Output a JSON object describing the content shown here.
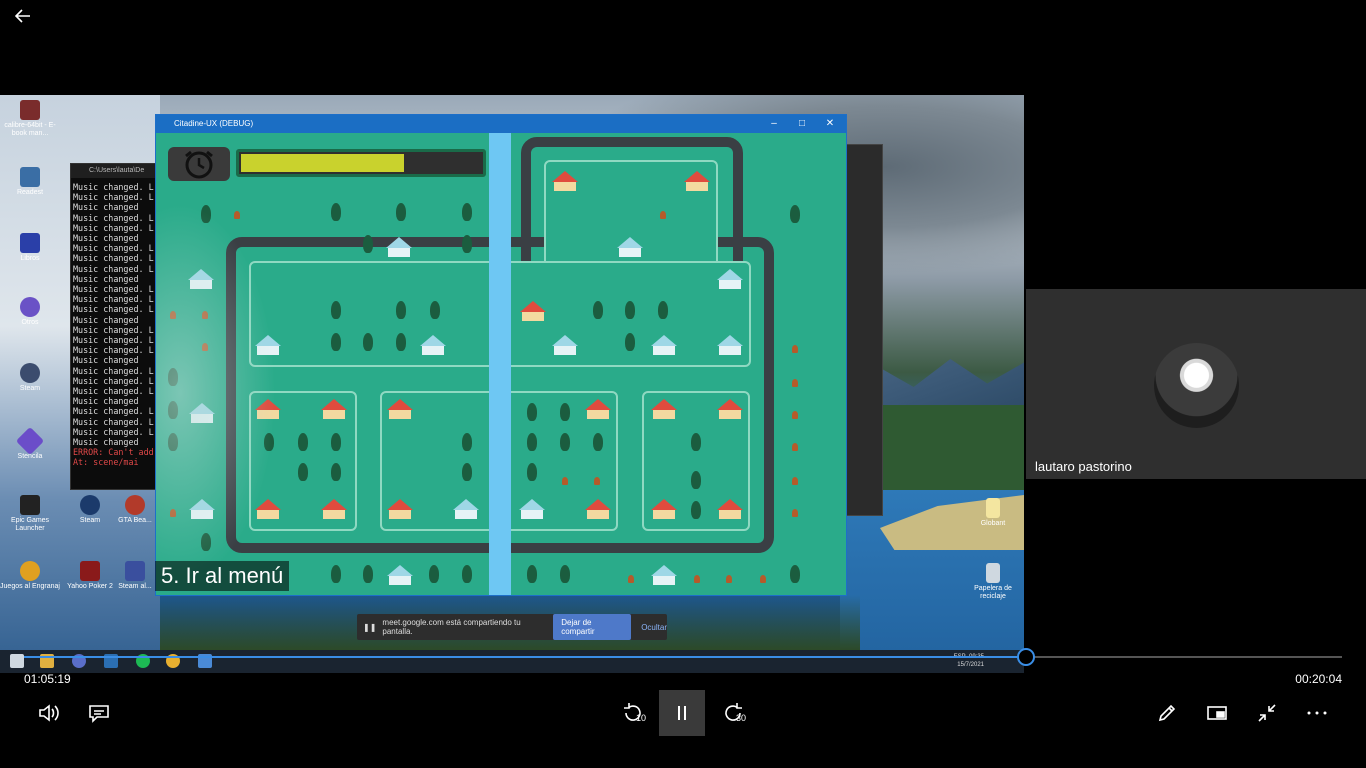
{
  "player": {
    "elapsed": "01:05:19",
    "total": "00:20:04",
    "progress_fraction": 0.76,
    "skip_back_seconds": "10",
    "skip_forward_seconds": "30"
  },
  "icons": {
    "back": "back-arrow-icon",
    "volume": "volume-icon",
    "captions": "captions-icon",
    "skip_back": "skip-back-10-icon",
    "pause": "pause-icon",
    "skip_forward": "skip-forward-30-icon",
    "edit": "pencil-icon",
    "miniplayer": "miniplayer-icon",
    "exit_fullscreen": "exit-fullscreen-icon",
    "more": "more-icon"
  },
  "participant": {
    "name": "lautaro pastorino"
  },
  "video": {
    "game_window_title": "Citadine-UX (DEBUG)",
    "caption": "5. Ir al menú",
    "progress_bar_fraction": 0.68,
    "console_title": "C:\\Users\\lauta\\De",
    "console_lines": [
      "Music changed. L",
      "Music changed. L",
      "Music changed",
      "Music changed. L",
      "Music changed. L",
      "Music changed",
      "Music changed. L",
      "Music changed. L",
      "Music changed. L",
      "Music changed",
      "Music changed. L",
      "Music changed. L",
      "Music changed. L",
      "Music changed",
      "Music changed. L",
      "Music changed. L",
      "Music changed. L",
      "Music changed",
      "Music changed. L",
      "Music changed. L",
      "Music changed. L",
      "Music changed",
      "Music changed. L",
      "Music changed. L",
      "Music changed. L",
      "Music changed",
      "ERROR: Can't add",
      "    At: scene/mai"
    ],
    "share_bar": {
      "message": "meet.google.com está compartiendo tu pantalla.",
      "stop_label": "Dejar de compartir",
      "hide_label": "Ocultar"
    },
    "desktop_icons": [
      "calibre-64bit - E-book man...",
      "Readest",
      "Libros",
      "Otros",
      "Steam",
      "Stencila",
      "Epic Games Launcher",
      "Steam",
      "GTA Bea...",
      "Juegos al Engranaj",
      "Yahoo Poker 2",
      "Steam al...",
      "Globant",
      "Papelera de reciclaje"
    ],
    "taskbar_clock": {
      "time": "09:35",
      "date": "15/7/2021",
      "lang": "ESP"
    }
  }
}
